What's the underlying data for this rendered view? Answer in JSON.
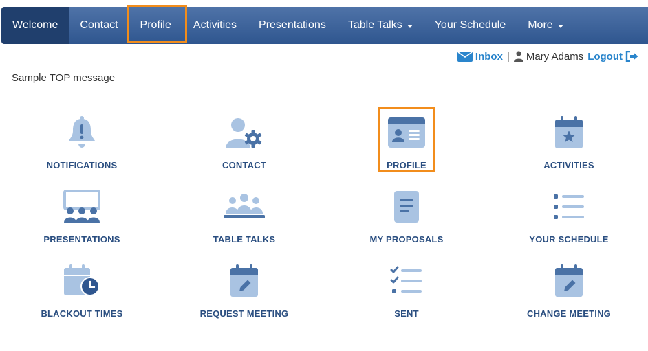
{
  "nav": {
    "items": [
      {
        "label": "Welcome",
        "active": true
      },
      {
        "label": "Contact"
      },
      {
        "label": "Profile"
      },
      {
        "label": "Activities"
      },
      {
        "label": "Presentations"
      },
      {
        "label": "Table Talks",
        "dropdown": true
      },
      {
        "label": "Your Schedule"
      },
      {
        "label": "More",
        "dropdown": true
      }
    ]
  },
  "userbar": {
    "inbox_label": "Inbox",
    "separator": "|",
    "user_name": "Mary Adams",
    "logout_label": "Logout"
  },
  "top_message": "Sample TOP message",
  "tiles": [
    {
      "label": "NOTIFICATIONS",
      "icon": "bell-icon"
    },
    {
      "label": "CONTACT",
      "icon": "user-gear-icon"
    },
    {
      "label": "PROFILE",
      "icon": "id-card-icon"
    },
    {
      "label": "ACTIVITIES",
      "icon": "calendar-star-icon"
    },
    {
      "label": "PRESENTATIONS",
      "icon": "presentation-audience-icon"
    },
    {
      "label": "TABLE TALKS",
      "icon": "group-table-icon"
    },
    {
      "label": "MY PROPOSALS",
      "icon": "document-icon"
    },
    {
      "label": "YOUR SCHEDULE",
      "icon": "list-icon"
    },
    {
      "label": "BLACKOUT TIMES",
      "icon": "calendar-clock-icon"
    },
    {
      "label": "REQUEST MEETING",
      "icon": "calendar-pen-icon"
    },
    {
      "label": "SENT",
      "icon": "checklist-icon"
    },
    {
      "label": "CHANGE MEETING",
      "icon": "calendar-pen-icon"
    }
  ],
  "colors": {
    "nav_bg": "#3f659c",
    "nav_active": "#203f6d",
    "highlight": "#f28d1c",
    "link": "#2a85cc",
    "icon_dark": "#4a72a6",
    "icon_light": "#a9c3e2",
    "label": "#2a4e80"
  }
}
